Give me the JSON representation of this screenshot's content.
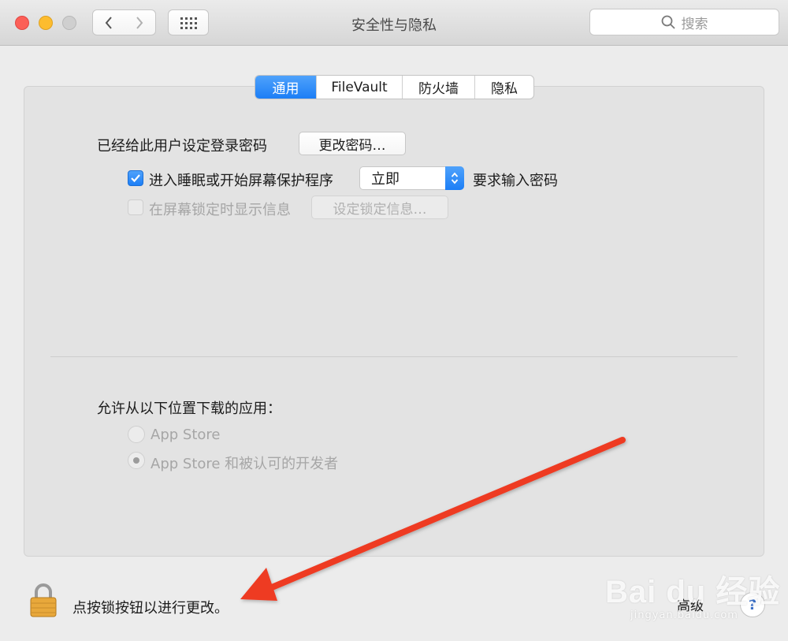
{
  "window": {
    "title": "安全性与隐私"
  },
  "toolbar": {
    "search_placeholder": "搜索"
  },
  "tabs": [
    {
      "label": "通用",
      "active": true
    },
    {
      "label": "FileVault",
      "active": false
    },
    {
      "label": "防火墙",
      "active": false
    },
    {
      "label": "隐私",
      "active": false
    }
  ],
  "general": {
    "password_label": "已经给此用户设定登录密码",
    "change_password_button": "更改密码…",
    "sleep_checkbox_label": "进入睡眠或开始屏幕保护程序",
    "sleep_checkbox_checked": true,
    "require_select_value": "立即",
    "require_suffix": "要求输入密码",
    "lock_message_checkbox_label": "在屏幕锁定时显示信息",
    "lock_message_checkbox_checked": false,
    "set_lock_message_button": "设定锁定信息…",
    "downloads_label": "允许从以下位置下载的应用：",
    "radio_options": [
      {
        "label": "App Store",
        "selected": false
      },
      {
        "label": "App Store 和被认可的开发者",
        "selected": true
      }
    ]
  },
  "footer": {
    "lock_message": "点按锁按钮以进行更改。",
    "advanced_button": "高级",
    "help_button": "?"
  },
  "watermark": {
    "logo_text": "Bai du 经验",
    "url": "jingyan.baidu.com"
  },
  "colors": {
    "accent": "#1c7ef6",
    "annotation_arrow": "#ee3a24",
    "lock_gold": "#e8a83b"
  }
}
